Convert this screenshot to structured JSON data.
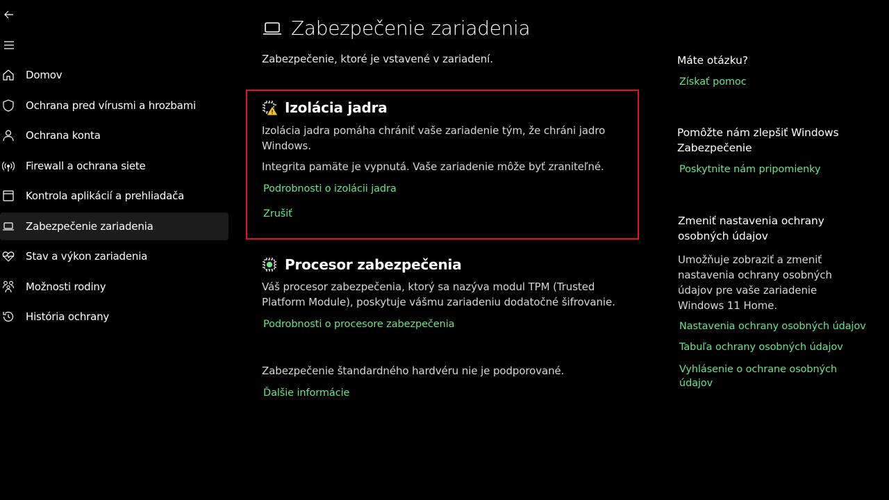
{
  "nav": {
    "back_icon": "back-arrow-icon",
    "menu_icon": "hamburger-menu-icon",
    "items": [
      {
        "label": "Domov",
        "icon": "home-icon"
      },
      {
        "label": "Ochrana pred vírusmi a hrozbami",
        "icon": "shield-icon"
      },
      {
        "label": "Ochrana konta",
        "icon": "person-icon"
      },
      {
        "label": "Firewall a ochrana siete",
        "icon": "wifi-antenna-icon"
      },
      {
        "label": "Kontrola aplikácií a prehliadača",
        "icon": "app-window-icon"
      },
      {
        "label": "Zabezpečenie zariadenia",
        "icon": "laptop-icon",
        "active": true
      },
      {
        "label": "Stav a výkon zariadenia",
        "icon": "heart-pulse-icon"
      },
      {
        "label": "Možnosti rodiny",
        "icon": "family-icon"
      },
      {
        "label": "História ochrany",
        "icon": "history-icon"
      }
    ]
  },
  "main": {
    "title": "Zabezpečenie zariadenia",
    "subtitle": "Zabezpečenie, ktoré je vstavené v zariadení.",
    "core_isolation": {
      "title": "Izolácia jadra",
      "description": "Izolácia jadra pomáha chrániť vaše zariadenie tým, že chráni jadro Windows.",
      "status": "Integrita pamäte je vypnutá. Vaše zariadenie môže byť zraniteľné.",
      "details_link": "Podrobnosti o izolácii jadra",
      "dismiss_link": "Zrušiť"
    },
    "security_processor": {
      "title": "Procesor zabezpečenia",
      "description": "Váš procesor zabezpečenia, ktorý sa nazýva modul TPM (Trusted Platform Module), poskytuje vášmu zariadeniu dodatočné šifrovanie.",
      "details_link": "Podrobnosti o procesore zabezpečenia"
    },
    "hardware": {
      "text": "Zabezpečenie štandardného hardvéru nie je podporované.",
      "link": "Ďalšie informácie"
    }
  },
  "right": {
    "question_head": "Máte otázku?",
    "help_link": "Získať pomoc",
    "improve_head": "Pomôžte nám zlepšiť Windows Zabezpečenie",
    "feedback_link": "Poskytnite nám pripomienky",
    "privacy_head": "Zmeniť nastavenia ochrany osobných údajov",
    "privacy_text": "Umožňuje zobraziť a zmeniť nastavenia ochrany osobných údajov pre vaše zariadenie Windows 11 Home.",
    "privacy_settings_link": "Nastavenia ochrany osobných údajov",
    "privacy_dashboard_link": "Tabuľa ochrany osobných údajov",
    "privacy_statement_link": "Vyhlásenie o ochrane osobných údajov"
  },
  "colors": {
    "accent_link": "#68e38b",
    "highlight_border": "#e81123",
    "warning": "#f2c811"
  }
}
